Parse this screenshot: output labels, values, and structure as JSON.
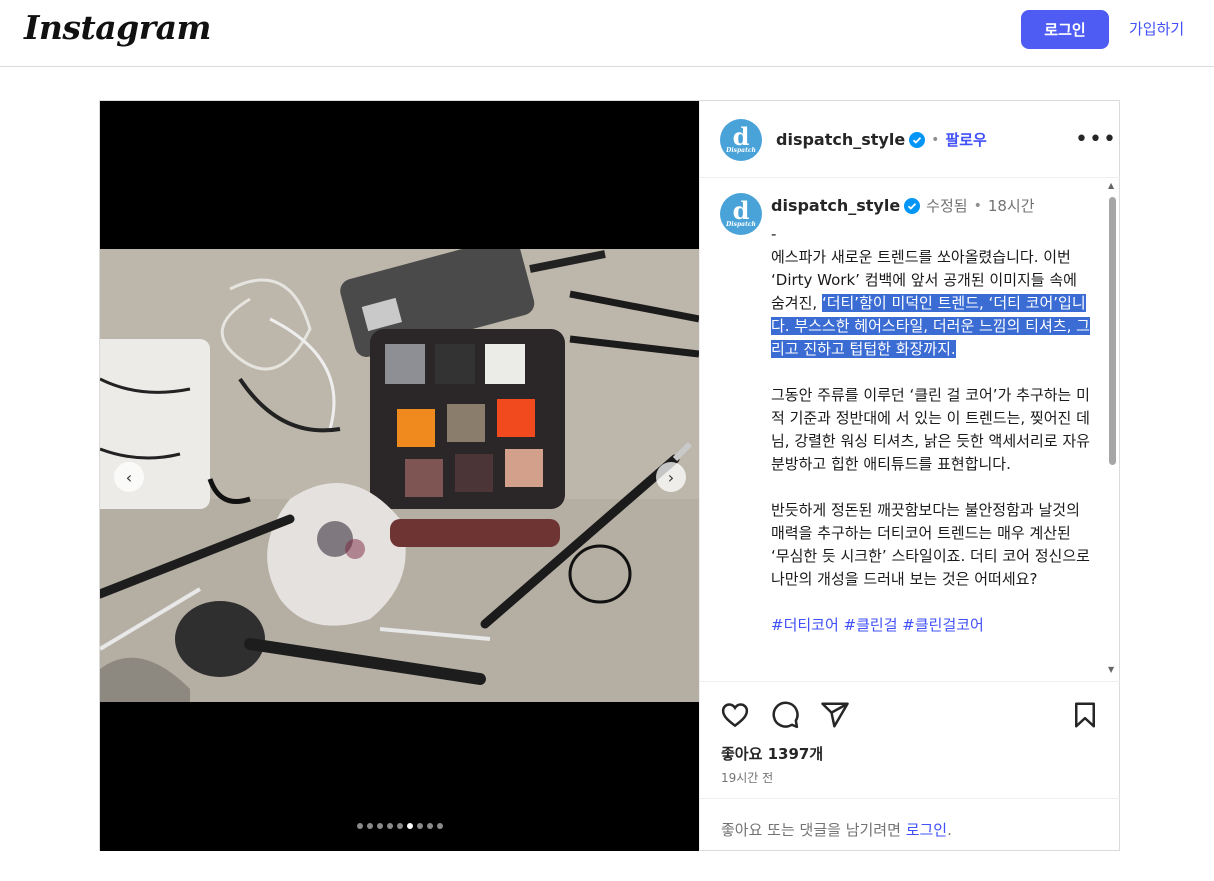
{
  "header": {
    "logo": "Instagram",
    "login_label": "로그인",
    "signup_label": "가입하기"
  },
  "post": {
    "username": "dispatch_style",
    "follow_label": "팔로우",
    "header_separator": "•",
    "more_label": "•••",
    "avatar_big": "d",
    "avatar_small": "Dispatch",
    "caption": {
      "username": "dispatch_style",
      "edited": "수정됨",
      "separator": "•",
      "time": "18시간",
      "dash": "-",
      "text_before_highlight": "에스파가 새로운 트렌드를 쏘아올렸습니다. 이번 ‘Dirty Work’ 컴백에 앞서 공개된 이미지들 속에 숨겨진, ",
      "text_highlight": "‘더티’함이 미덕인 트렌드, ‘더티 코어’입니다. 부스스한 헤어스타일, 더러운 느낌의 티셔츠, 그리고 진하고 텁텁한 화장까지.",
      "paragraph2": "그동안 주류를 이루던 ‘클린 걸 코어’가 추구하는 미적 기준과 정반대에 서 있는 이 트렌드는, 찢어진 데님, 강렬한 워싱 티셔츠, 낡은 듯한 액세서리로 자유분방하고 힙한 애티튜드를 표현합니다.",
      "paragraph3": "반듯하게 정돈된 깨끗함보다는 불안정함과 날것의 매력을 추구하는 더티코어 트렌드는 매우 계산된 ‘무심한 듯 시크한’ 스타일이죠. 더티 코어 정신으로 나만의 개성을 드러내 보는 것은 어떠세요?",
      "hashtags": "#더티코어 #클린걸 #클린걸코어"
    },
    "likes_label": "좋아요 1397개",
    "posted_ago": "19시간 전",
    "login_prompt_text": "좋아요 또는 댓글을 남기려면 ",
    "login_prompt_link": "로그인",
    "login_prompt_end": ".",
    "carousel": {
      "total": 9,
      "active_index": 5
    }
  },
  "colors": {
    "accent": "#4150f7",
    "login_button": "#4f5cf3",
    "highlight": "#3b6cd3",
    "avatar": "#4aa3d8"
  },
  "icons": [
    "heart-icon",
    "comment-icon",
    "share-icon",
    "bookmark-icon",
    "verified-icon",
    "chevron-left-icon",
    "chevron-right-icon",
    "more-icon"
  ]
}
